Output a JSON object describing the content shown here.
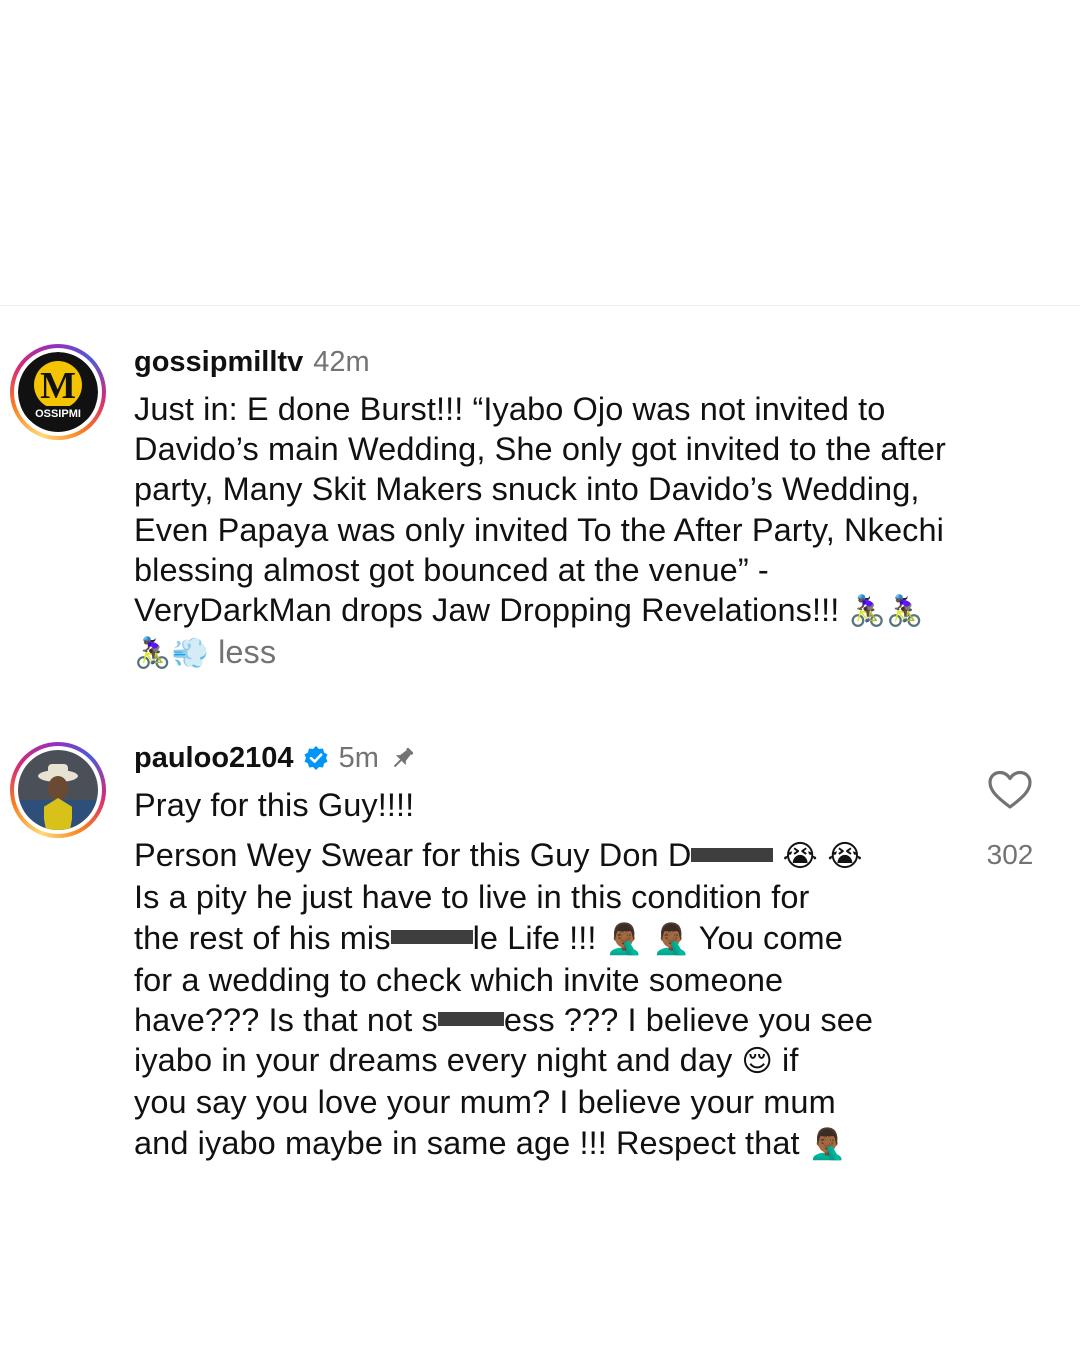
{
  "comments": [
    {
      "username": "gossipmilltv",
      "time": "42m",
      "avatar_text": "M",
      "avatar_band": "OSSIPMI",
      "text_lines": [
        "Just in: E done Burst!!! “Iyabo Ojo was not invited to",
        "Davido’s main Wedding, She only got invited to the after",
        "party, Many Skit Makers snuck into Davido’s Wedding,",
        "Even Papaya was only invited To the After Party, Nkechi",
        "blessing almost got bounced at the venue” -",
        "VeryDarkMan drops Jaw Dropping Revelations!!!"
      ],
      "emoji_line1": "🚴🏿‍♀️🚴🏿‍♀️",
      "emoji_line2": "🚴🏿‍♀️💨",
      "less_label": "less"
    },
    {
      "username": "pauloo2104",
      "verified": true,
      "time": "5m",
      "pinned": true,
      "first_line": "Pray for this Guy!!!!",
      "lines": {
        "l1a": "Person Wey Swear for this Guy Don D",
        "l1b": "😭 😭",
        "l2": "Is a pity he just have to live in this condition for",
        "l3a": "the rest of his mis",
        "l3b": "le Life !!! ",
        "l3c": "🤦🏾‍♂️ 🤦🏾‍♂️",
        "l3d": " You come",
        "l4": "for a wedding to check which invite someone",
        "l5a": "have??? Is that not s",
        "l5b": "ess ??? I believe you see",
        "l6a": "iyabo in your dreams every night and day ",
        "l6b": "😌",
        "l6c": " if",
        "l7": "you say you love your mum? I believe your mum",
        "l8a": "and iyabo maybe in same age !!! Respect that ",
        "l8b": "🤦🏾‍♂️"
      },
      "like_count": "302"
    }
  ],
  "colors": {
    "secondary_text": "#737373",
    "verified_blue": "#0095f6",
    "avatar_badge_yellow": "#f5c400"
  },
  "icons": {
    "verified": "verified-badge-icon",
    "pin": "pin-icon",
    "like": "heart-outline-icon"
  }
}
